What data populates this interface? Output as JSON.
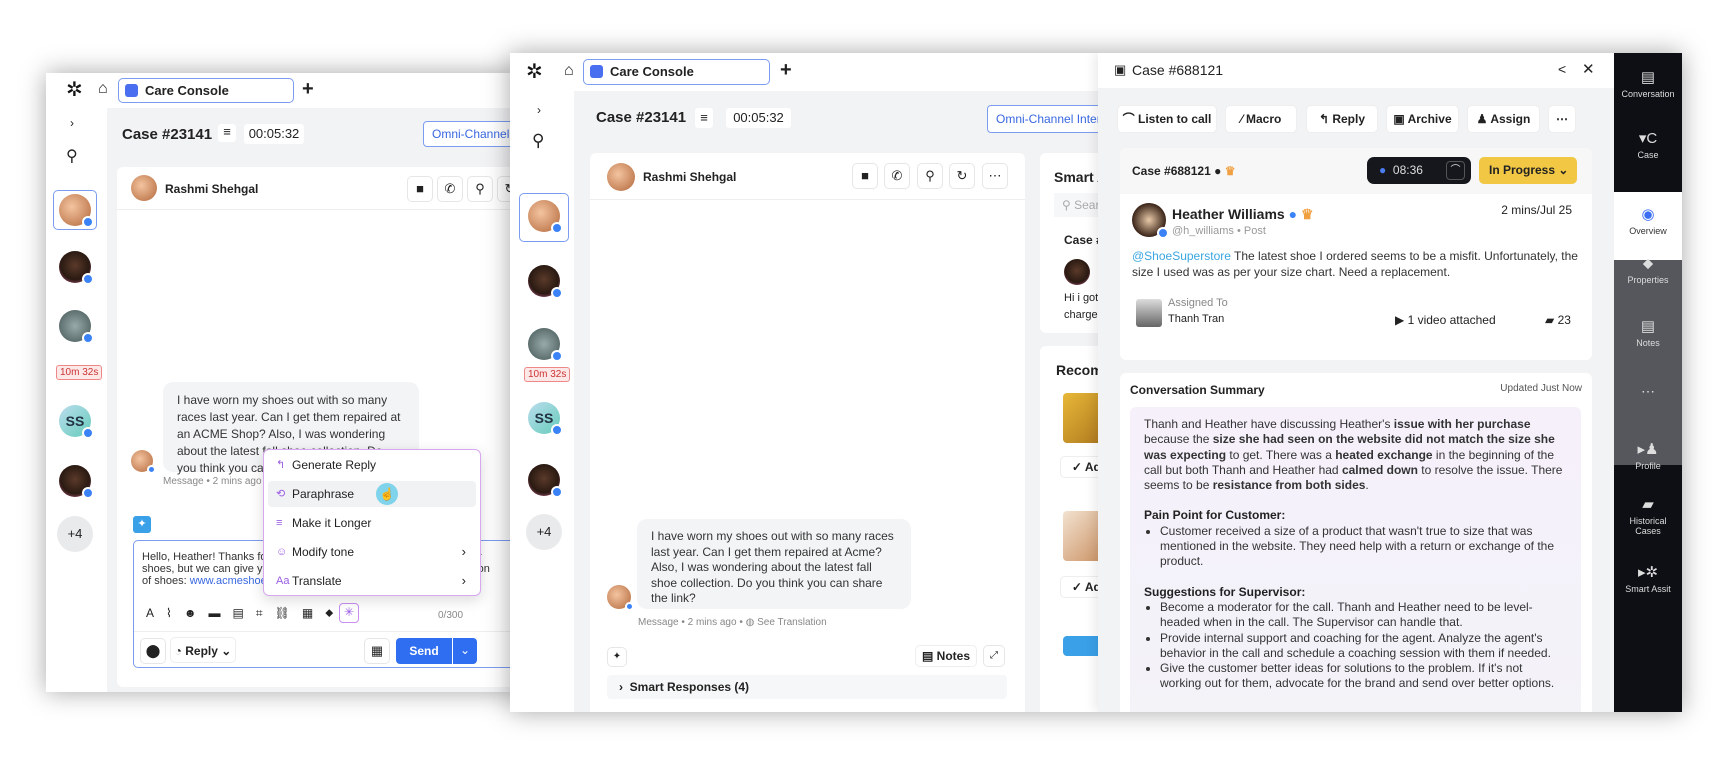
{
  "back_window": {
    "tab_label": "Care Console",
    "case_title": "Case #23141",
    "timer": "00:05:32",
    "omni_label": "Omni-Channel Interactions",
    "contact_name": "Rashmi Shehgal",
    "rail": {
      "badge": "10m 32s",
      "ss_initials": "SS",
      "more": "+4"
    },
    "message": "I have worn my shoes out with so many races last year. Can I get them repaired at an ACME Shop? Also, I was wondering about the latest fall shoe collection. Do you think you can share the link?",
    "message_meta": "Message • 2 mins ago",
    "compose_text": "Hello, Heather! Thanks for reaching out. Unfortunately, we can't repair shoes, but we can give you a discount on a new pair from our collection of shoes: ",
    "compose_link": "www.acmeshoes.com/collection",
    "char_count": "0/300",
    "reply_label": "Reply",
    "send_label": "Send",
    "ai_menu": [
      {
        "label": "Generate Reply",
        "icon": "reply-icon"
      },
      {
        "label": "Paraphrase",
        "icon": "paraphrase-icon"
      },
      {
        "label": "Make it Longer",
        "icon": "lines-icon"
      },
      {
        "label": "Modify tone",
        "icon": "tone-icon",
        "submenu": true
      },
      {
        "label": "Translate",
        "icon": "translate-icon",
        "submenu": true
      }
    ]
  },
  "front_window": {
    "tab_label": "Care Console",
    "case_title": "Case #23141",
    "timer": "00:05:32",
    "omni_label": "Omni-Channel Interactions",
    "contact_name": "Rashmi Shehgal",
    "rail": {
      "badge": "10m 32s",
      "ss_initials": "SS",
      "more": "+4"
    },
    "message": "I have worn my shoes out with so many races last year. Can I get them repaired at Acme? Also, I was wondering about the latest fall shoe collection. Do you think you can share the link?",
    "message_meta": "Message • 2 mins ago •",
    "see_translation": "See Translation",
    "notes_label": "Notes",
    "smart_responses": "Smart Responses (4)",
    "smart_assist": {
      "title": "Smart Assist",
      "search_placeholder": "Search",
      "case_label": "Case #",
      "snippet": "Hi i got charger",
      "recommended": "Recommended",
      "add_label": "Add"
    }
  },
  "case_panel": {
    "title": "Case #688121",
    "actions": [
      "Listen to call",
      "Macro",
      "Reply",
      "Archive",
      "Assign"
    ],
    "case_id": "Case #688121",
    "call_timer": "08:36",
    "status": "In Progress",
    "time": "2 mins/Jul 25",
    "author": "Heather Williams",
    "handle": "@h_williams • Post",
    "mention": "@ShoeSuperstore",
    "post": " The latest shoe I ordered seems to be a misfit. Unfortunately, the size I used was as per your size chart. Need a replacement.",
    "assigned_label": "Assigned To",
    "assignee": "Thanh Tran",
    "video": "1 video attached",
    "comments": "23",
    "summary_title": "Conversation Summary",
    "summary_updated": "Updated Just Now",
    "summary_p": [
      "Thanh and Heather have discussing Heather's ",
      "issue with her purchase",
      " because the ",
      "size she had seen on the website did not match the size she was expecting",
      " to get. There was a ",
      "heated exchange",
      " in the beginning of the call but both Thanh and Heather had ",
      "calmed down",
      " to resolve the issue. There seems to be ",
      "resistance from both sides",
      "."
    ],
    "pain_title": "Pain Point for Customer:",
    "pain": [
      "Customer received a size of a product that wasn't true to size that was mentioned in the website. They need help with a return or exchange of the product."
    ],
    "sugg_title": "Suggestions for Supervisor:",
    "suggestions": [
      "Become a moderator for the call. Thanh and Heather need to be level-headed when in the call. The Supervisor can handle that.",
      "Provide internal support and coaching for the agent. Analyze the agent's behavior in the call and schedule a coaching session with them if needed.",
      "Give the customer better ideas for solutions to the problem. If it's not working out for them, advocate for the brand and send over better options."
    ]
  },
  "right_rail": [
    {
      "label": "Conversation",
      "icon": "conversation-icon"
    },
    {
      "label": "Case",
      "icon": "case-icon"
    },
    {
      "label": "Overview",
      "icon": "eye-icon",
      "active": true
    },
    {
      "label": "Properties",
      "icon": "tag-icon"
    },
    {
      "label": "Notes",
      "icon": "notes-icon"
    },
    {
      "label": "Profile",
      "icon": "user-icon"
    },
    {
      "label": "Historical Cases",
      "icon": "chat-icon"
    },
    {
      "label": "Smart Assit",
      "icon": "sprinklr-icon"
    }
  ],
  "colors": {
    "accent": "#3867e0",
    "send": "#2f6ef0",
    "status": "#f2c744",
    "ai": "#9b5de5",
    "rail": "#0d0f14"
  }
}
